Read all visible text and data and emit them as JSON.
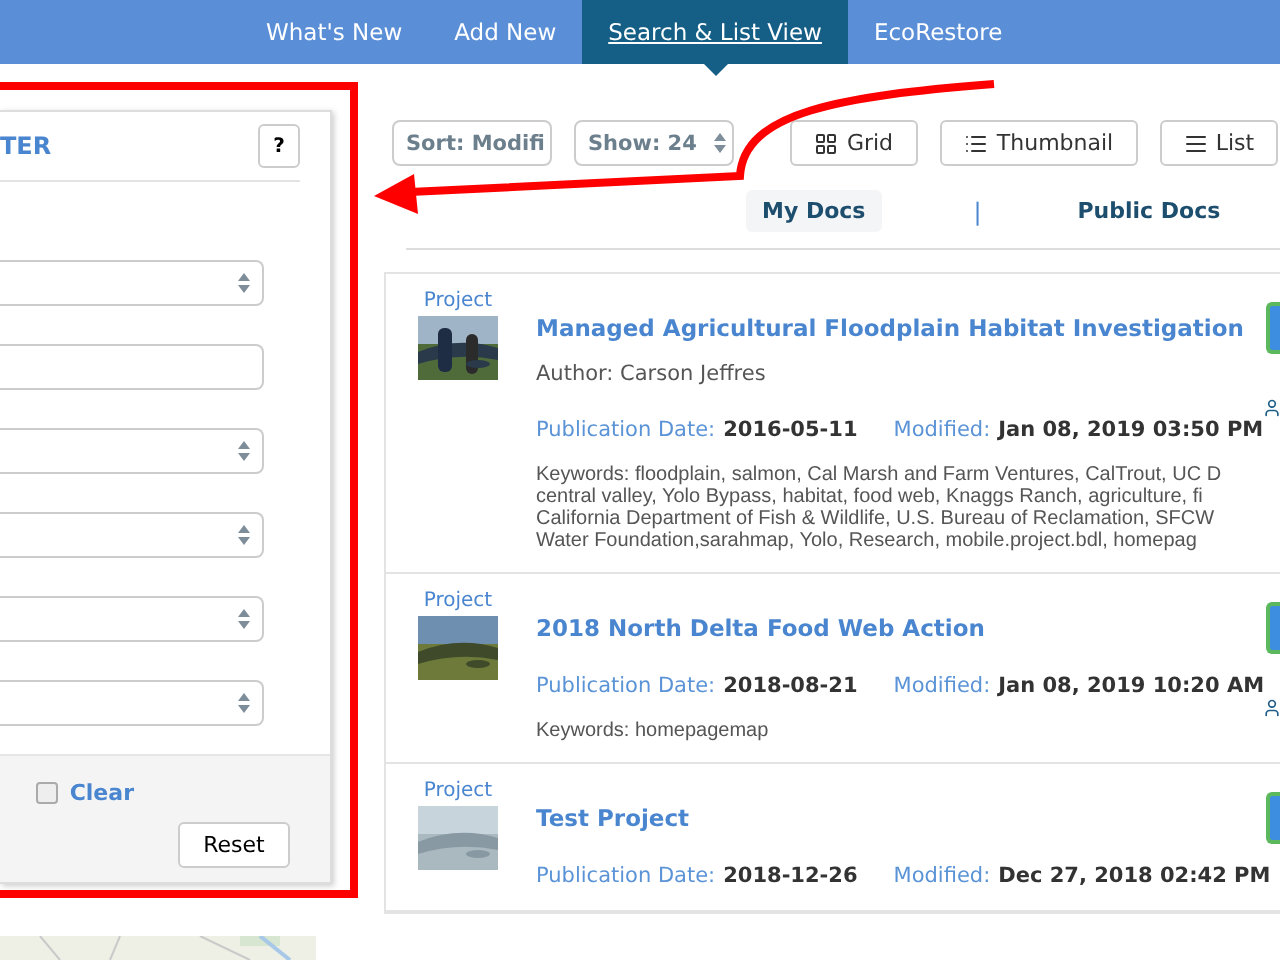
{
  "nav": {
    "tabs": [
      {
        "label": "What's New",
        "selected": false
      },
      {
        "label": "Add New",
        "selected": false
      },
      {
        "label": "Search & List View",
        "selected": true
      },
      {
        "label": "EcoRestore",
        "selected": false
      }
    ]
  },
  "filter_panel": {
    "title": "TER",
    "help": "?",
    "fields": [
      {
        "kind": "select"
      },
      {
        "kind": "input"
      },
      {
        "kind": "select"
      },
      {
        "kind": "select"
      },
      {
        "kind": "select"
      },
      {
        "kind": "select"
      }
    ],
    "clear": {
      "label": "Clear",
      "checked": false
    },
    "reset": "Reset"
  },
  "toolbar": {
    "sort": "Sort: Modifi",
    "show": "Show: 24",
    "views": [
      {
        "kind": "grid",
        "label": "Grid"
      },
      {
        "kind": "thumbnail",
        "label": "Thumbnail"
      },
      {
        "kind": "list",
        "label": "List"
      }
    ]
  },
  "doc_tabs": [
    {
      "label": "My Docs",
      "selected": true
    },
    {
      "label": "Public Docs",
      "selected": false
    }
  ],
  "doc_tab_separator": "|",
  "docs": [
    {
      "type": "Project",
      "title": "Managed Agricultural Floodplain Habitat Investigation",
      "author": "Author: Carson Jeffres",
      "publication_label": "Publication Date:",
      "publication_date": "2016-05-11",
      "modified_label": "Modified:",
      "modified": "Jan 08, 2019 03:50 PM",
      "keywords": [
        "Keywords: floodplain, salmon, Cal Marsh and Farm Ventures, CalTrout, UC D",
        "central valley, Yolo Bypass, habitat, food web, Knaggs Ranch, agriculture, fi",
        "California Department of Fish & Wildlife, U.S. Bureau of Reclamation, SFCW",
        "Water Foundation,sarahmap, Yolo, Research, mobile.project.bdl, homepag"
      ]
    },
    {
      "type": "Project",
      "title": "2018 North Delta Food Web Action",
      "publication_label": "Publication Date:",
      "publication_date": "2018-08-21",
      "modified_label": "Modified:",
      "modified": "Jan 08, 2019 10:20 AM",
      "keywords": [
        "Keywords: homepagemap"
      ]
    },
    {
      "type": "Project",
      "title": "Test Project",
      "publication_label": "Publication Date:",
      "publication_date": "2018-12-26",
      "modified_label": "Modified:",
      "modified": "Dec 27, 2018 02:42 PM"
    }
  ]
}
